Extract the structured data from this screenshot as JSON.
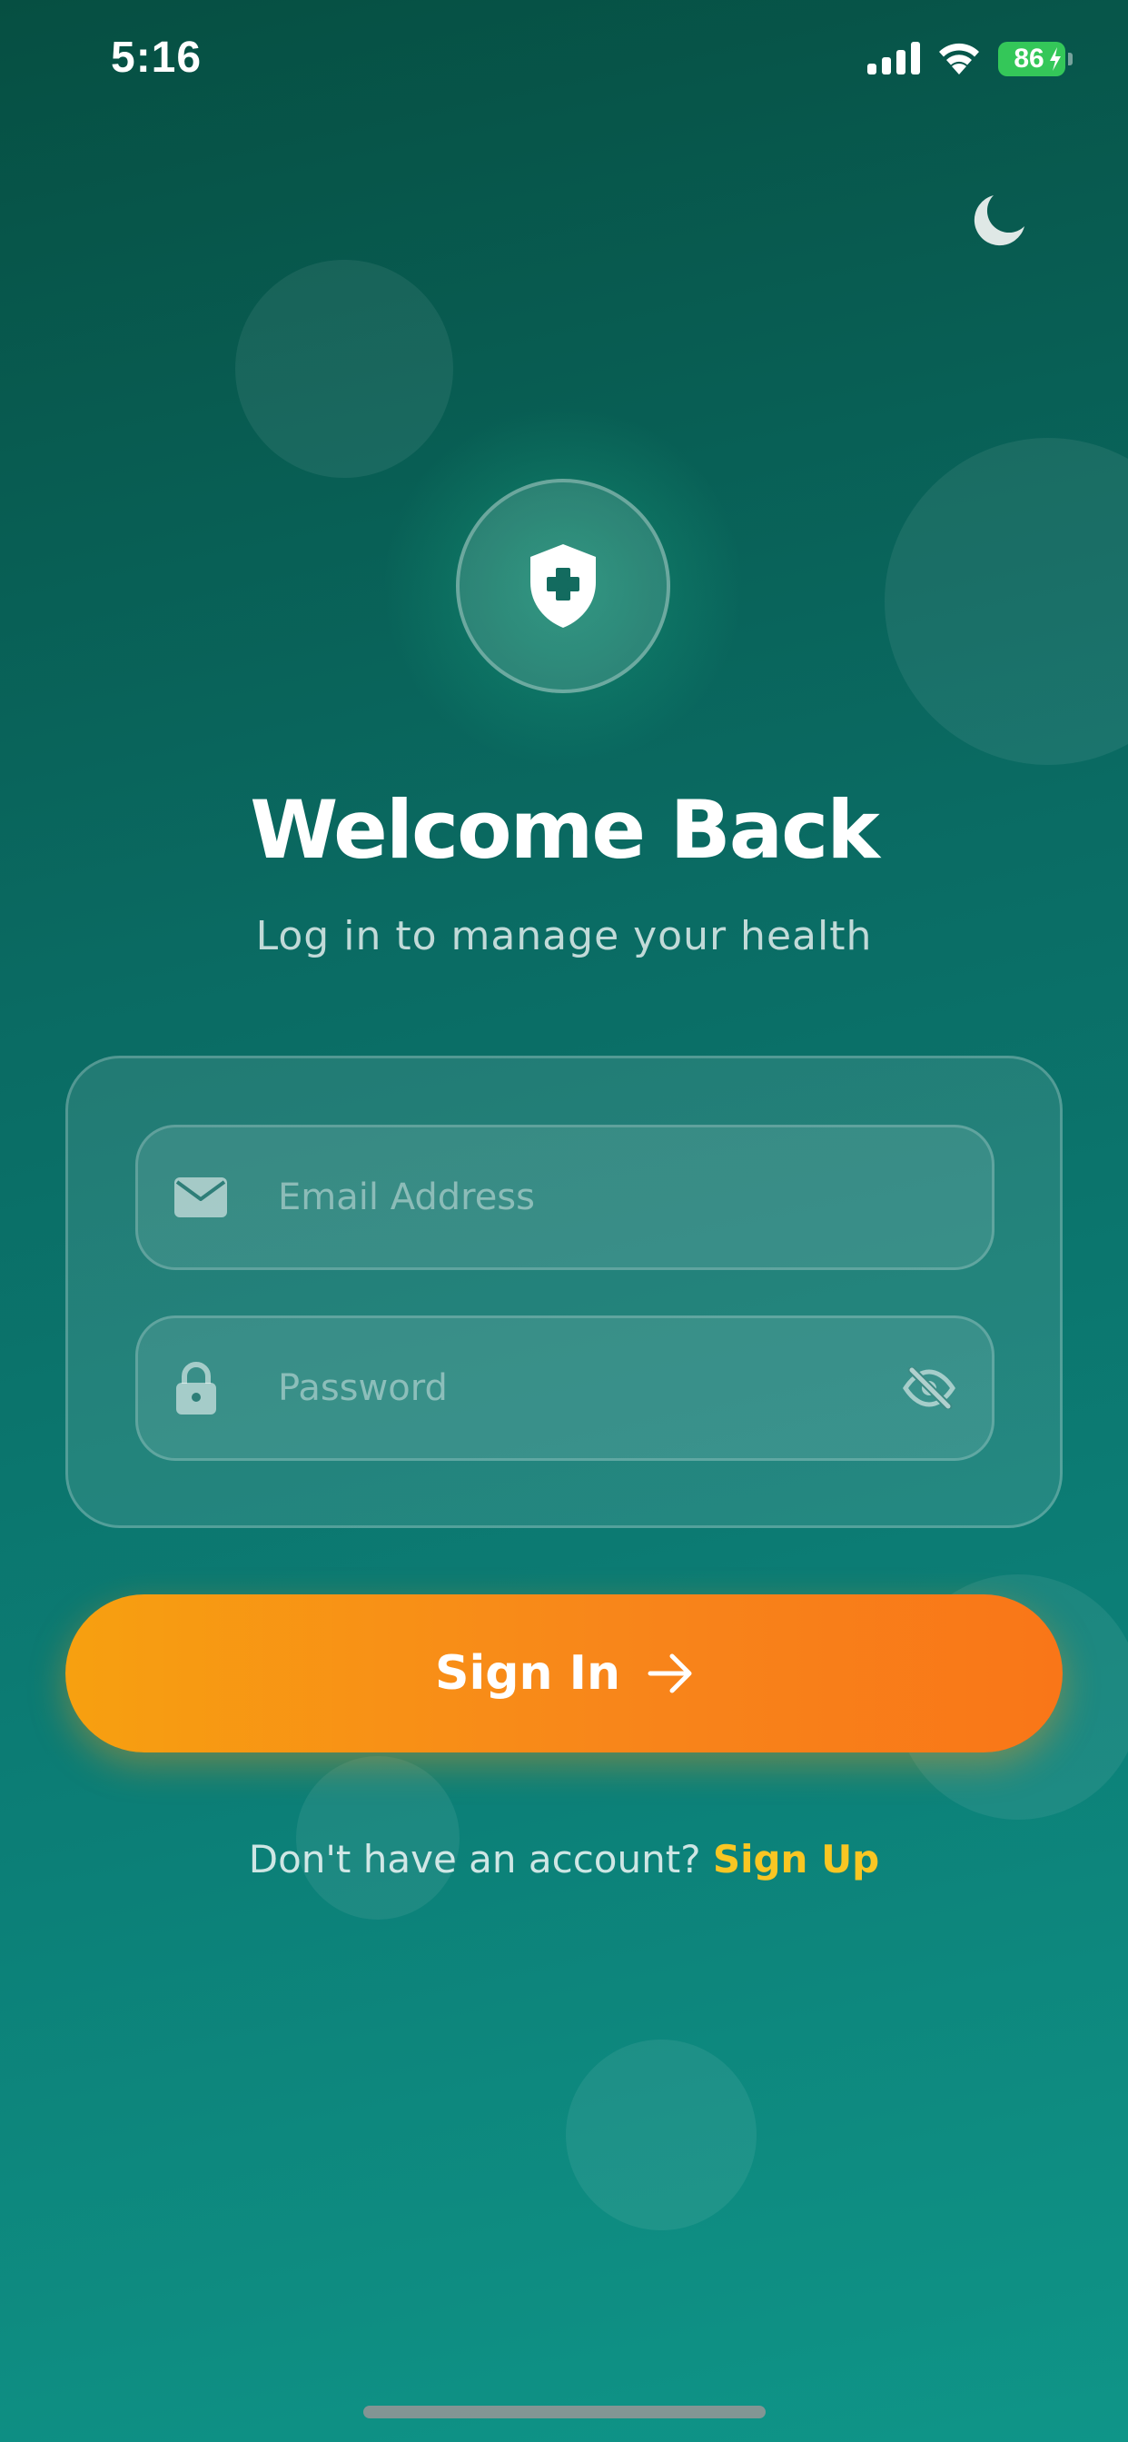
{
  "status_bar": {
    "time": "5:16",
    "battery": "86",
    "icons": [
      "cellular-signal-icon",
      "wifi-icon",
      "battery-icon",
      "charging-bolt-icon"
    ]
  },
  "header": {
    "theme_toggle_icon": "moon-icon",
    "logo_icon": "shield-plus-icon"
  },
  "title": "Welcome Back",
  "subtitle": "Log in to manage your health",
  "form": {
    "email": {
      "placeholder": "Email Address",
      "value": "",
      "icon": "envelope-icon"
    },
    "password": {
      "placeholder": "Password",
      "value": "",
      "icon": "lock-icon",
      "toggle_icon": "eye-slash-icon"
    },
    "submit_label": "Sign In",
    "submit_icon": "arrow-right-icon"
  },
  "footer": {
    "prompt": "Don't have an account?",
    "link": "Sign Up"
  },
  "colors": {
    "background_top": "#064f42",
    "background_bottom": "#0f9588",
    "button_start": "#f7a010",
    "button_end": "#f97618",
    "link": "#f9c623",
    "battery": "#34c759"
  }
}
